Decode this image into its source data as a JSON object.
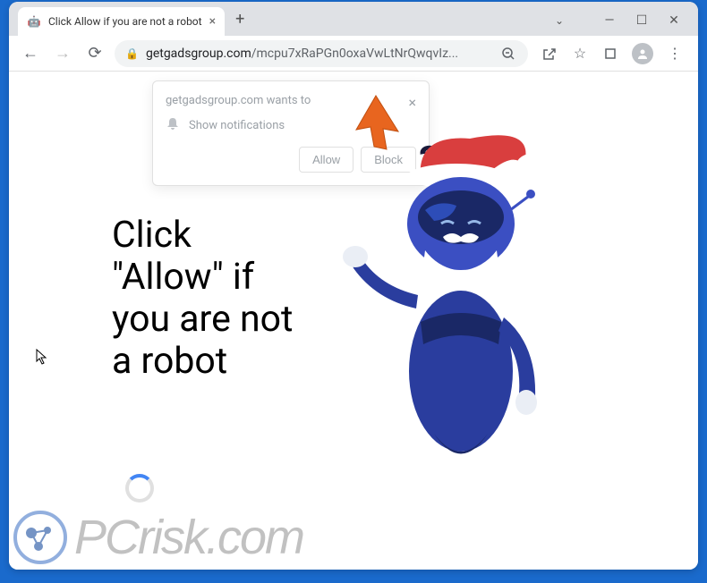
{
  "tab": {
    "title": "Click Allow if you are not a robot",
    "favicon": "🤖"
  },
  "toolbar": {
    "url_domain": "getgadsgroup.com",
    "url_path": "/mcpu7xRaPGn0oxaVwLtNrQwqvIz..."
  },
  "notification": {
    "title": "getgadsgroup.com wants to",
    "body": "Show notifications",
    "allow_label": "Allow",
    "block_label": "Block"
  },
  "page": {
    "heading_line1": "Click",
    "heading_line2": "\"Allow\" if",
    "heading_line3": "you are not",
    "heading_line4": "a robot",
    "question_mark": "?"
  },
  "watermark": {
    "text": "PCrisk.com"
  }
}
